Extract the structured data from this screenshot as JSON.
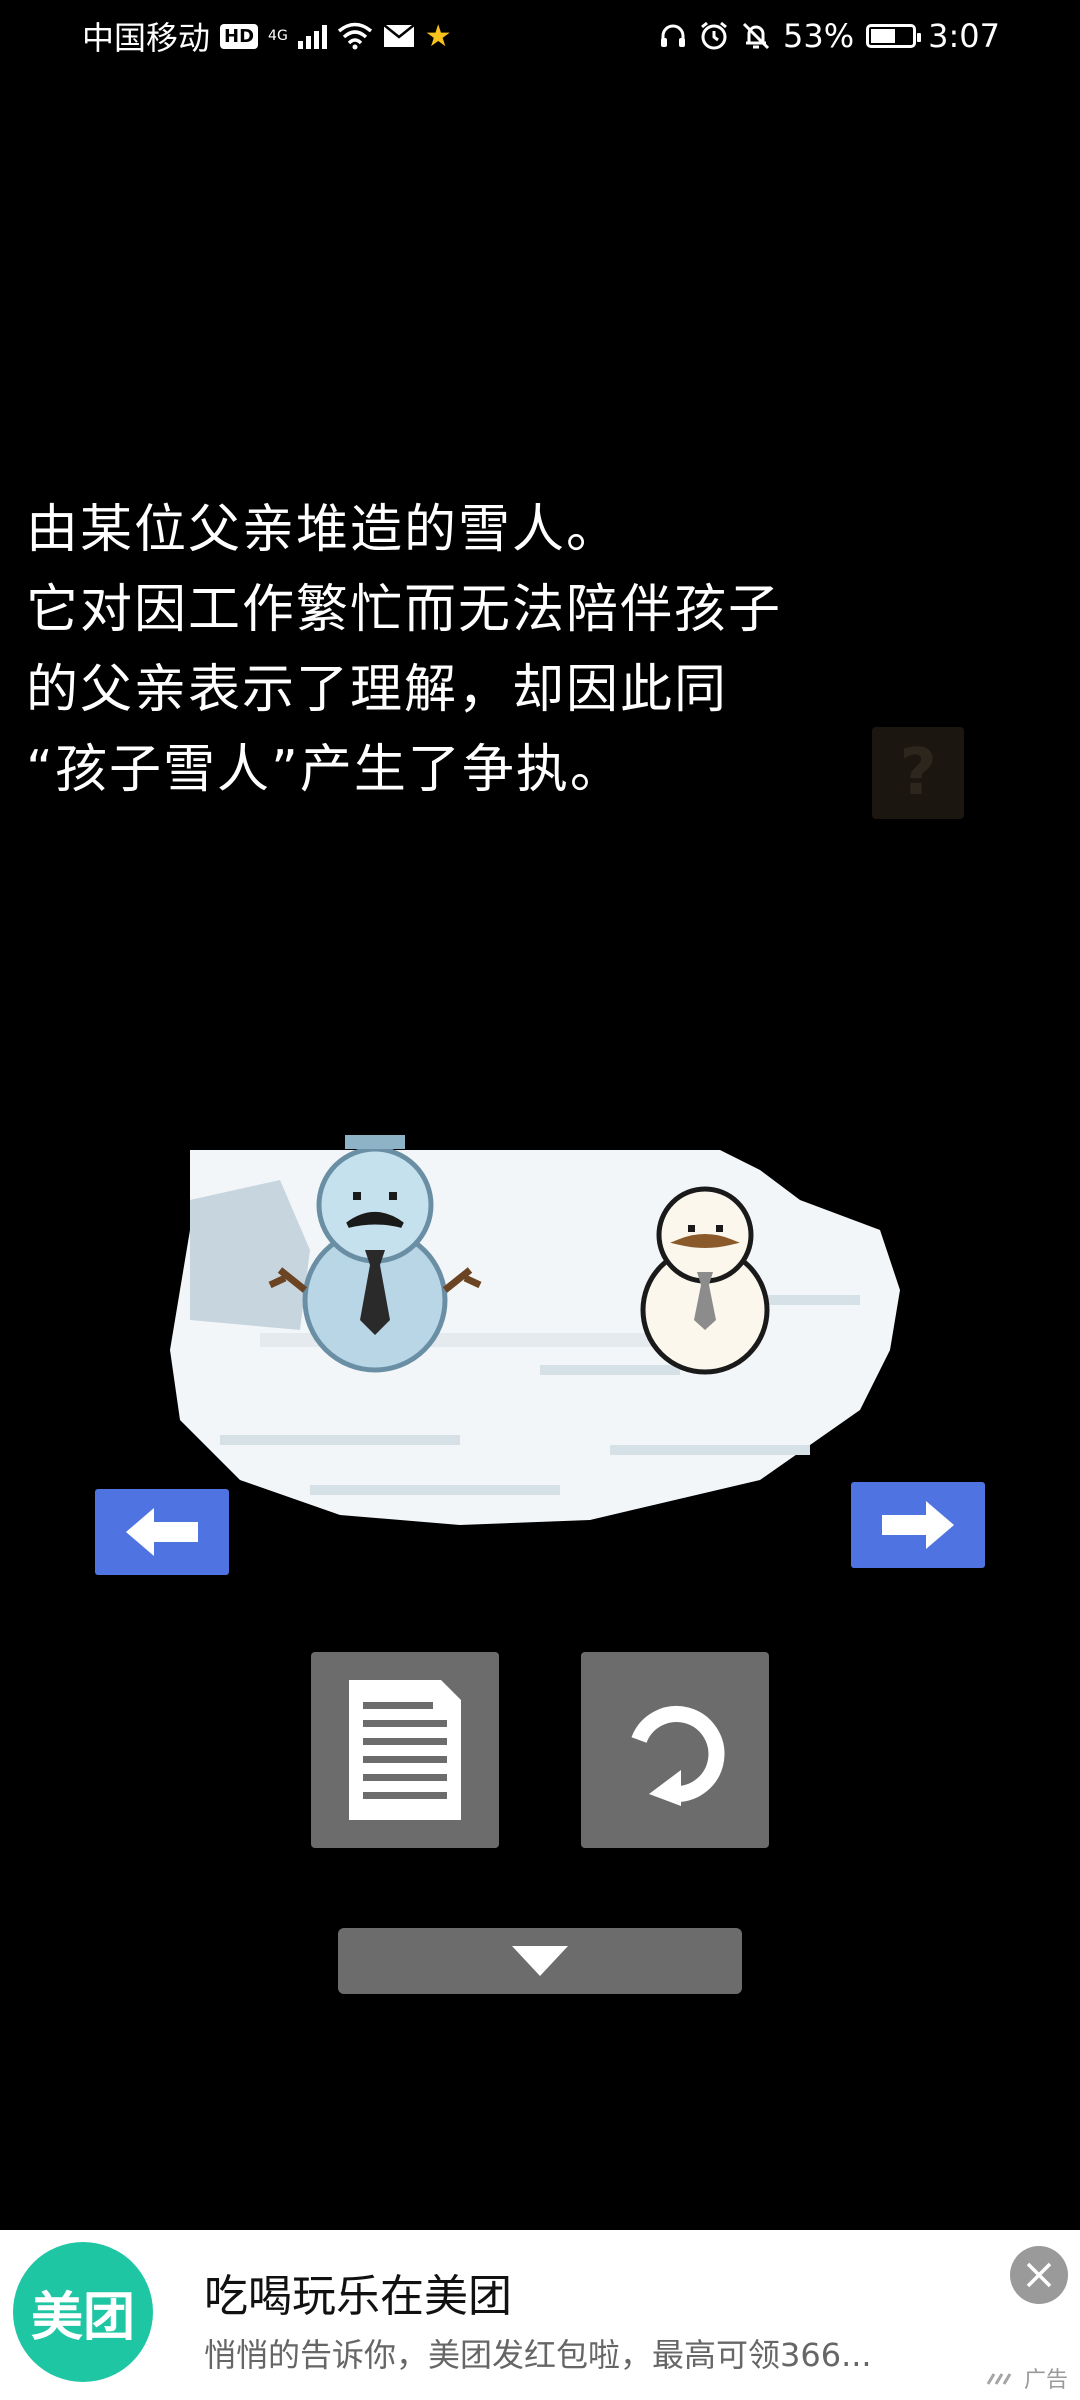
{
  "status_bar": {
    "carrier": "中国移动",
    "hd": "HD",
    "network": "4G",
    "battery_percent": "53%",
    "time": "3:07",
    "battery_level": 0.53,
    "icons": [
      "hd-icon",
      "signal-icon",
      "wifi-icon",
      "mail-icon",
      "star-icon",
      "headset-icon",
      "alarm-icon",
      "mute-icon",
      "battery-icon"
    ]
  },
  "game": {
    "description_lines": [
      "由某位父亲堆造的雪人。",
      "它对因工作繁忙而无法陪伴孩子",
      "的父亲表示了理解，却因此同",
      "“孩子雪人”产生了争执。"
    ],
    "hint_symbol": "?",
    "colors": {
      "arrow_button": "#4f73e0",
      "gray_button": "#6c6c6c",
      "snow": "#f3f6f8"
    }
  },
  "ad": {
    "logo_text": "美团",
    "title": "吃喝玩乐在美团",
    "subtitle": "悄悄的告诉你，美团发红包啦，最高可领366...",
    "label": "广告",
    "brand_color": "#1ec6a4"
  }
}
